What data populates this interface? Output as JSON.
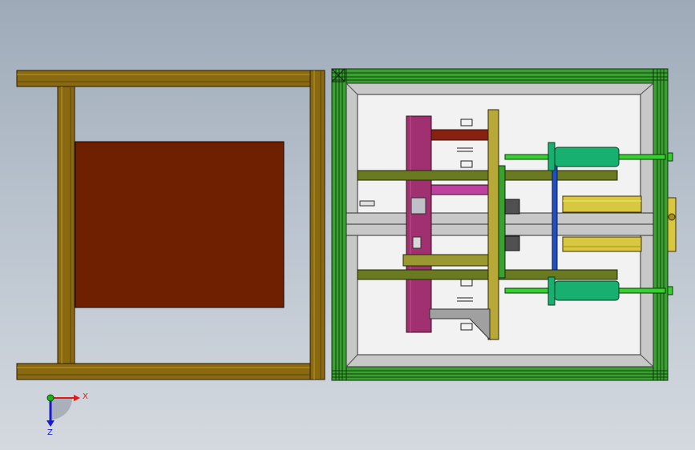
{
  "axes": {
    "x_label": "X",
    "z_label": "Z",
    "x_color": "#e01818",
    "y_color": "#18b418",
    "z_color": "#1818d8"
  },
  "colors": {
    "frame_wood": "#8a6a10",
    "frame_wood_dark": "#5a4408",
    "rust_plate": "#6e2000",
    "aluminum_green": "#3aa030",
    "inner_frame": "#c8c8c8",
    "magenta": "#a03070",
    "cylinder_teal": "#18b070",
    "brass": "#d8c840",
    "olive_rail": "#6a7a20",
    "blue_rail": "#2050c0"
  }
}
